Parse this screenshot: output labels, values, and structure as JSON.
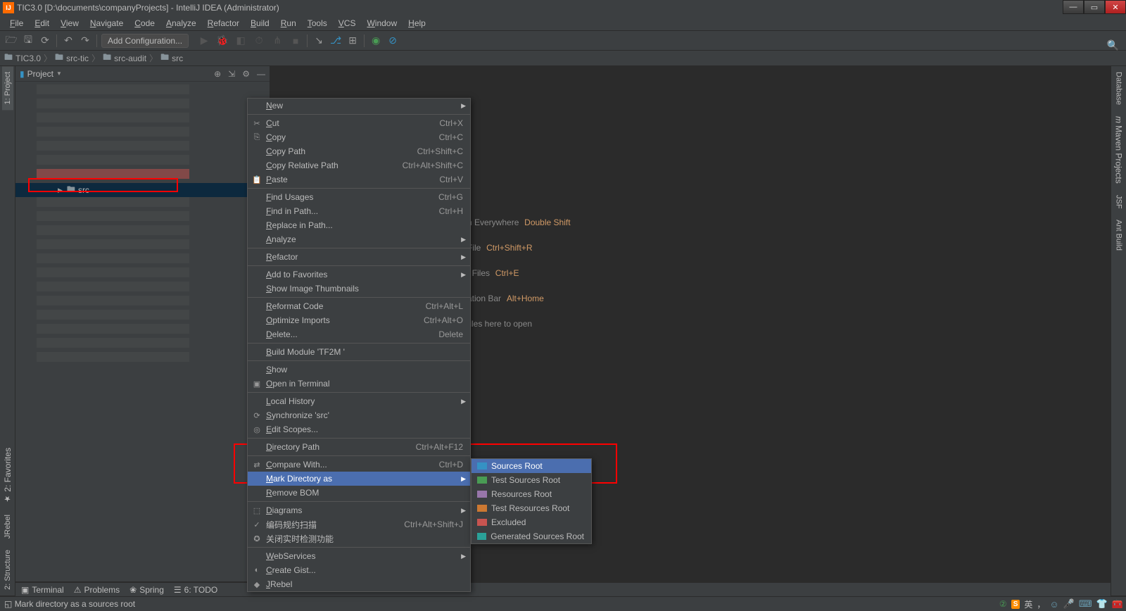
{
  "titlebar": {
    "text": "TIC3.0 [D:\\documents\\companyProjects] - IntelliJ IDEA (Administrator)",
    "icon_label": "IJ"
  },
  "menubar": [
    "File",
    "Edit",
    "View",
    "Navigate",
    "Code",
    "Analyze",
    "Refactor",
    "Build",
    "Run",
    "Tools",
    "VCS",
    "Window",
    "Help"
  ],
  "toolbar": {
    "add_config": "Add Configuration..."
  },
  "breadcrumb": [
    "TIC3.0",
    "src-tic",
    "src-audit",
    "src"
  ],
  "project_panel": {
    "title": "Project",
    "selected_node": "src"
  },
  "editor_hints": {
    "l1_a": "h Everywhere",
    "l1_b": "Double Shift",
    "l2_a": "File",
    "l2_b": "Ctrl+Shift+R",
    "l3_a": "t Files",
    "l3_b": "Ctrl+E",
    "l4_a": "ation Bar",
    "l4_b": "Alt+Home",
    "l5": "files here to open"
  },
  "context_menu": [
    {
      "label": "New",
      "arrow": true
    },
    {
      "sep": true
    },
    {
      "label": "Cut",
      "shortcut": "Ctrl+X",
      "icon": "✂"
    },
    {
      "label": "Copy",
      "shortcut": "Ctrl+C",
      "icon": "⎘"
    },
    {
      "label": "Copy Path",
      "shortcut": "Ctrl+Shift+C"
    },
    {
      "label": "Copy Relative Path",
      "shortcut": "Ctrl+Alt+Shift+C"
    },
    {
      "label": "Paste",
      "shortcut": "Ctrl+V",
      "icon": "📋"
    },
    {
      "sep": true
    },
    {
      "label": "Find Usages",
      "shortcut": "Ctrl+G"
    },
    {
      "label": "Find in Path...",
      "shortcut": "Ctrl+H"
    },
    {
      "label": "Replace in Path..."
    },
    {
      "label": "Analyze",
      "arrow": true
    },
    {
      "sep": true
    },
    {
      "label": "Refactor",
      "arrow": true
    },
    {
      "sep": true
    },
    {
      "label": "Add to Favorites",
      "arrow": true
    },
    {
      "label": "Show Image Thumbnails"
    },
    {
      "sep": true
    },
    {
      "label": "Reformat Code",
      "shortcut": "Ctrl+Alt+L"
    },
    {
      "label": "Optimize Imports",
      "shortcut": "Ctrl+Alt+O"
    },
    {
      "label": "Delete...",
      "shortcut": "Delete"
    },
    {
      "sep": true
    },
    {
      "label": "Build Module 'TF2M    '"
    },
    {
      "sep": true
    },
    {
      "label": "Show"
    },
    {
      "label": "Open in Terminal",
      "icon": "▣"
    },
    {
      "sep": true
    },
    {
      "label": "Local History",
      "arrow": true
    },
    {
      "label": "Synchronize 'src'",
      "icon": "⟳"
    },
    {
      "label": "Edit Scopes...",
      "icon": "◎"
    },
    {
      "sep": true
    },
    {
      "label": "Directory Path",
      "shortcut": "Ctrl+Alt+F12"
    },
    {
      "sep": true
    },
    {
      "label": "Compare With...",
      "shortcut": "Ctrl+D",
      "icon": "⇄"
    },
    {
      "label": "Mark Directory as",
      "arrow": true,
      "hl": true
    },
    {
      "label": "Remove BOM"
    },
    {
      "sep": true
    },
    {
      "label": "Diagrams",
      "arrow": true,
      "icon": "⬚"
    },
    {
      "label": "编码规约扫描",
      "shortcut": "Ctrl+Alt+Shift+J",
      "icon": "✓"
    },
    {
      "label": "关闭实时检测功能",
      "icon": "✪"
    },
    {
      "sep": true
    },
    {
      "label": "WebServices",
      "arrow": true
    },
    {
      "label": "Create Gist...",
      "icon": "◐"
    },
    {
      "label": "JRebel",
      "icon": "◆"
    }
  ],
  "submenu": [
    {
      "label": "Sources Root",
      "cls": "src-blue",
      "hl": true
    },
    {
      "label": "Test Sources Root",
      "cls": "src-green"
    },
    {
      "label": "Resources Root",
      "cls": "src-purple"
    },
    {
      "label": "Test Resources Root",
      "cls": "src-orange"
    },
    {
      "label": "Excluded",
      "cls": "src-red"
    },
    {
      "label": "Generated Sources Root",
      "cls": "src-teal"
    }
  ],
  "left_tabs": {
    "top": [
      "1: Project"
    ],
    "bottom": [
      "2: Favorites",
      "JRebel",
      "2: Structure"
    ]
  },
  "right_tabs": [
    "Database",
    "Maven Projects",
    "JSF",
    "Ant Build"
  ],
  "bottom_tools": [
    "Terminal",
    "Problems",
    "Spring",
    "6: TODO"
  ],
  "status": {
    "text": "Mark directory as a sources root",
    "ime": "S",
    "lang": "英"
  }
}
